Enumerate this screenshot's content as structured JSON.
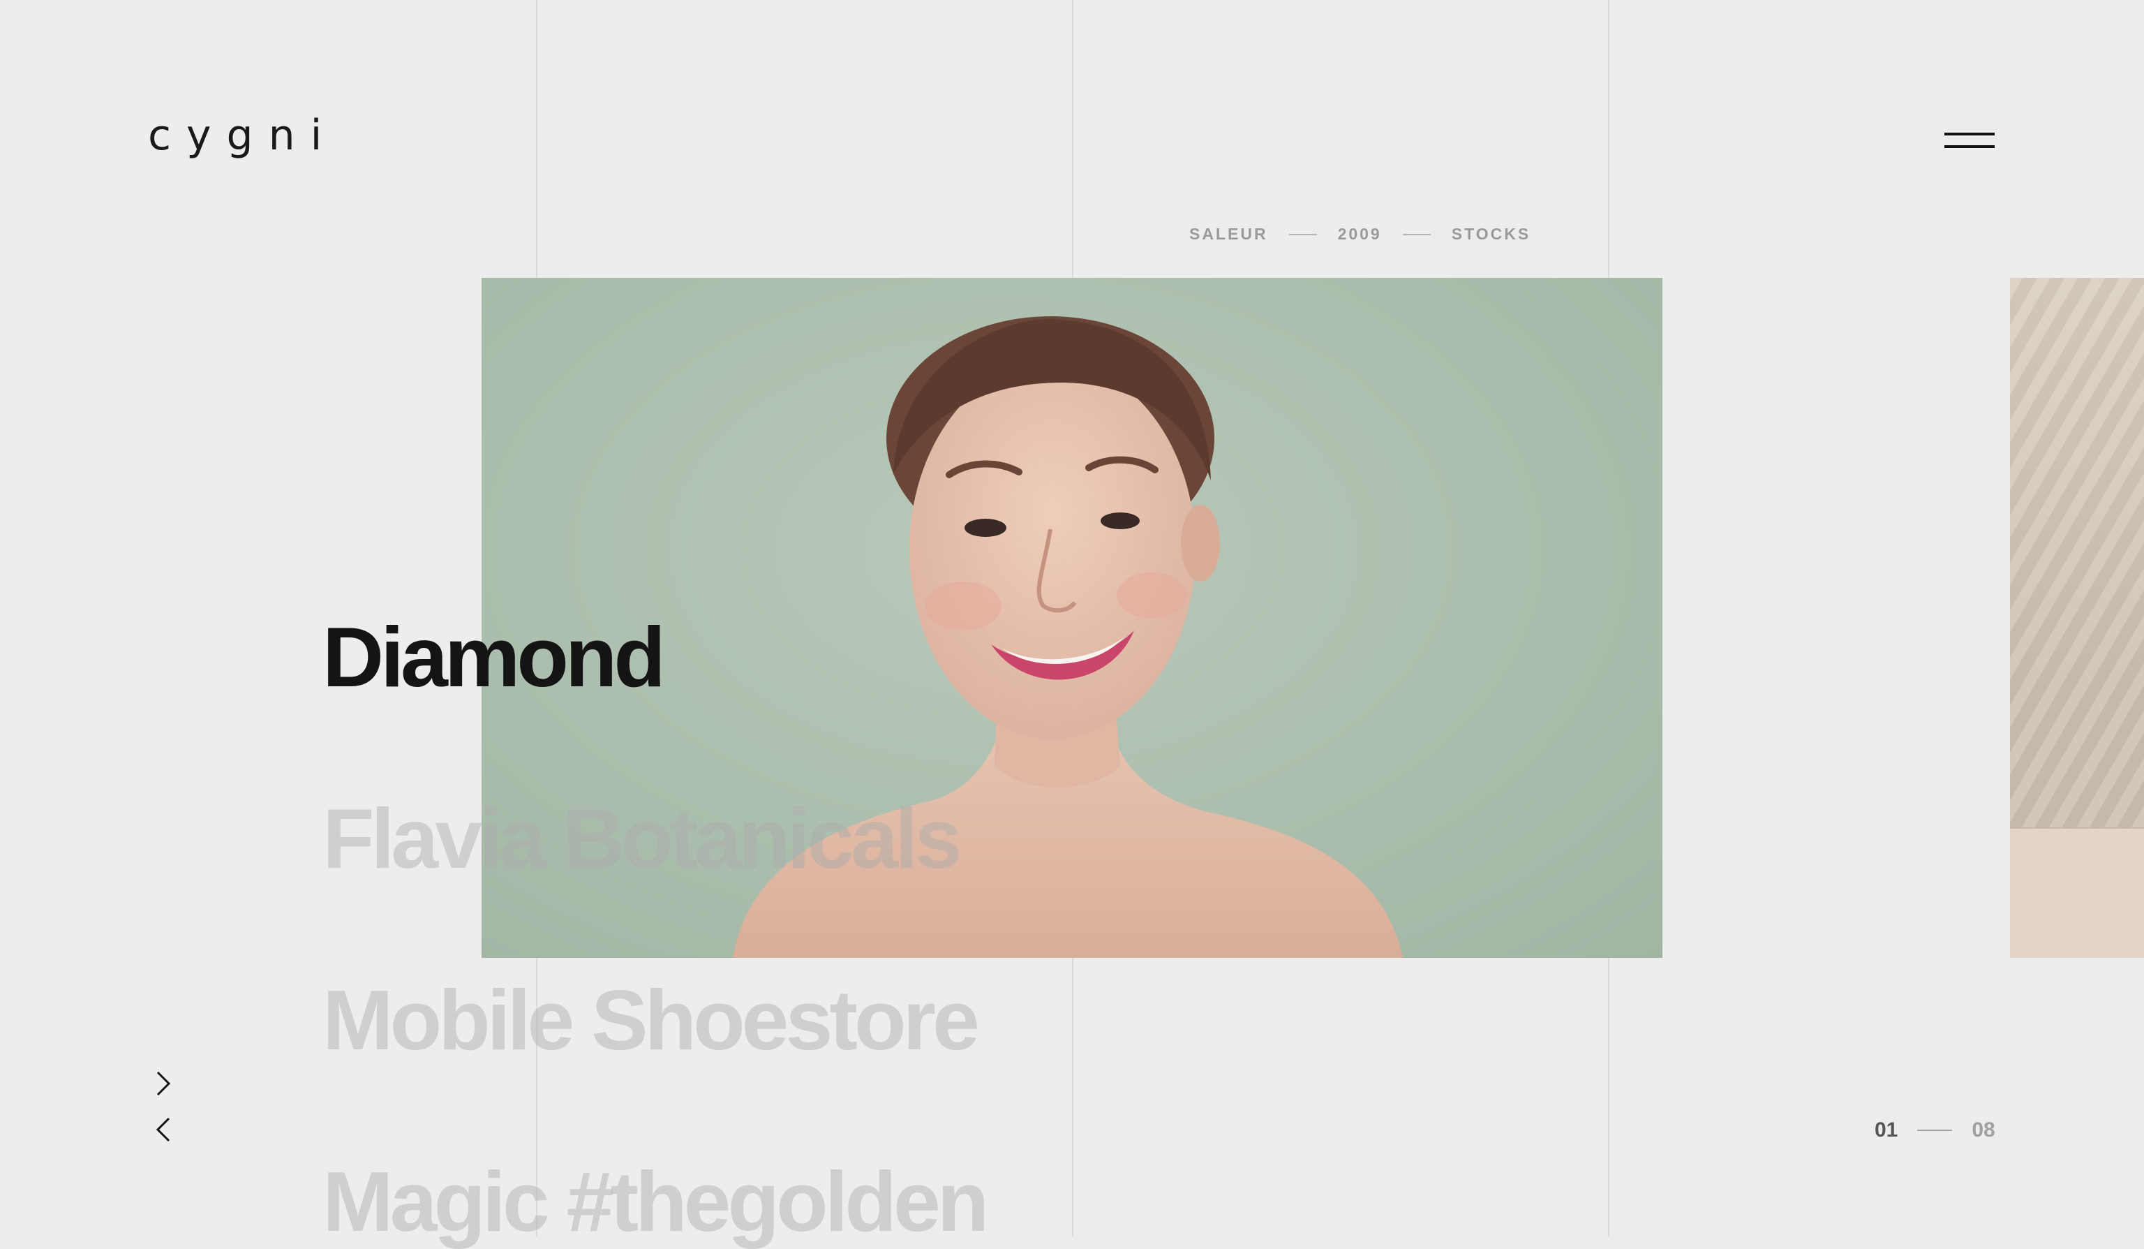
{
  "brand": {
    "logo_text": "cygni"
  },
  "header": {
    "menu_icon": "hamburger-icon"
  },
  "project_meta": {
    "client": "SALEUR",
    "year": "2009",
    "category": "STOCKS"
  },
  "projects": [
    {
      "title": "Diamond",
      "active": true
    },
    {
      "title": "Flavia Botanicals",
      "active": false
    },
    {
      "title": "Mobile Shoestore",
      "active": false
    },
    {
      "title": "Magic #thegolden",
      "active": false
    }
  ],
  "slider": {
    "next_icon": "chevron-right-icon",
    "prev_icon": "chevron-left-icon",
    "current": "01",
    "total": "08"
  },
  "colors": {
    "background": "#ededed",
    "grid_line": "#dcdcdc",
    "hero_bg": "#adbfae",
    "text_active": "#141414",
    "text_dim": "#aaaaaa"
  }
}
